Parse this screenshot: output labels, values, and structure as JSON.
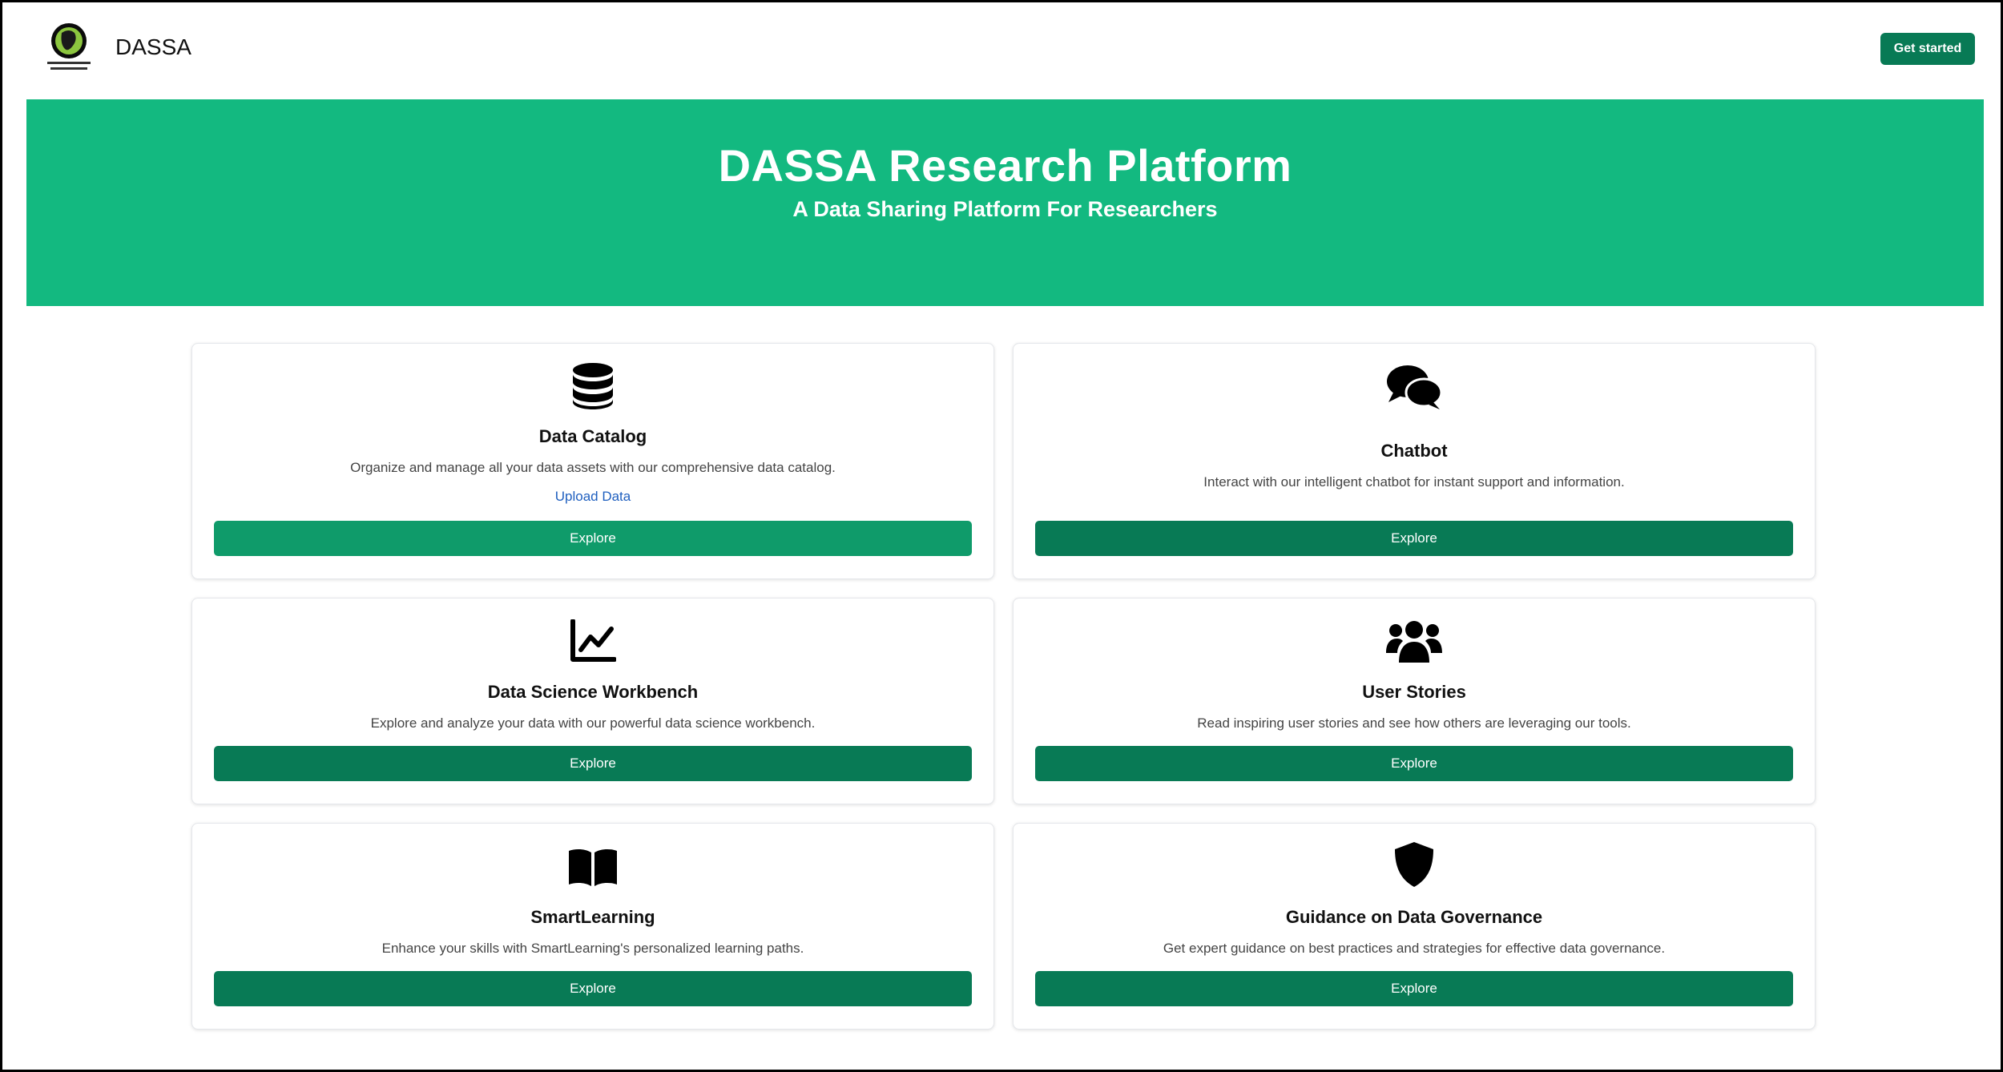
{
  "header": {
    "brand": "DASSA",
    "get_started_label": "Get started"
  },
  "hero": {
    "title": "DASSA Research Platform",
    "subtitle": "A Data Sharing Platform For Researchers"
  },
  "colors": {
    "hero_green": "#13b980",
    "button_green": "#087a55",
    "button_green_light": "#0f9b6a",
    "link_blue": "#1f5fbf"
  },
  "cards": [
    {
      "icon": "database-icon",
      "title": "Data Catalog",
      "description": "Organize and manage all your data assets with our comprehensive data catalog.",
      "link": "Upload Data",
      "button": "Explore"
    },
    {
      "icon": "chat-bubbles-icon",
      "title": "Chatbot",
      "description": "Interact with our intelligent chatbot for instant support and information.",
      "button": "Explore"
    },
    {
      "icon": "line-chart-icon",
      "title": "Data Science Workbench",
      "description": "Explore and analyze your data with our powerful data science workbench.",
      "button": "Explore"
    },
    {
      "icon": "users-icon",
      "title": "User Stories",
      "description": "Read inspiring user stories and see how others are leveraging our tools.",
      "button": "Explore"
    },
    {
      "icon": "book-icon",
      "title": "SmartLearning",
      "description": "Enhance your skills with SmartLearning's personalized learning paths.",
      "button": "Explore"
    },
    {
      "icon": "shield-icon",
      "title": "Guidance on Data Governance",
      "description": "Get expert guidance on best practices and strategies for effective data governance.",
      "button": "Explore"
    }
  ]
}
